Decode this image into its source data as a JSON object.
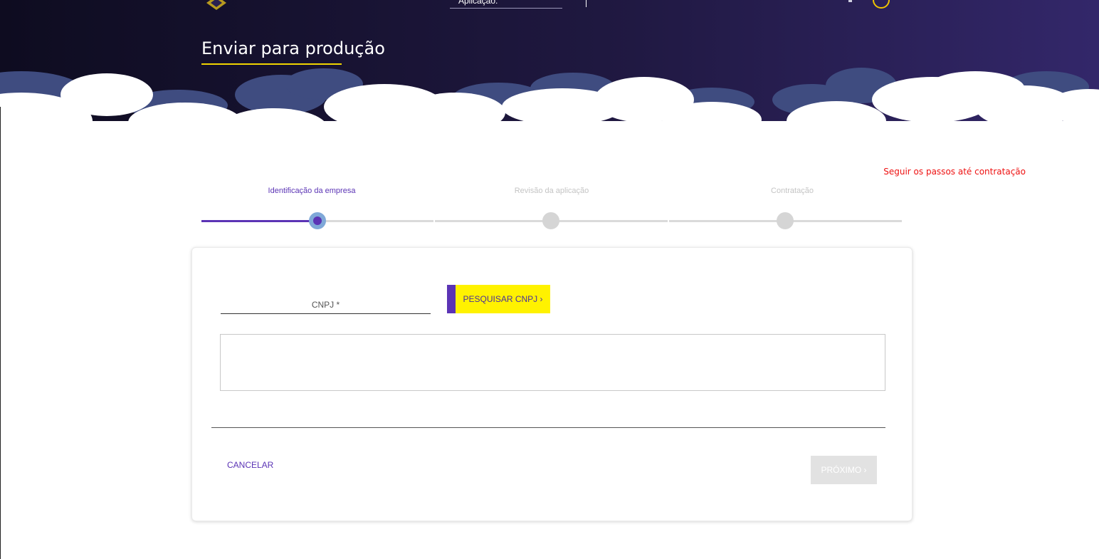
{
  "header": {
    "page_title": "Enviar para produção",
    "app_selector_label": "Aplicação:",
    "app_selector_chevron": "⌄"
  },
  "hint": "Seguir os passos até contratação",
  "stepper": {
    "steps": [
      {
        "label": "Identificação da empresa",
        "state": "active"
      },
      {
        "label": "Revisão da aplicação",
        "state": "pending"
      },
      {
        "label": "Contratação",
        "state": "pending"
      }
    ]
  },
  "form": {
    "cnpj_label": "CNPJ *",
    "cnpj_value": "",
    "search_button": "PESQUISAR CNPJ ›",
    "cancel_button": "CANCELAR",
    "next_button": "PRÓXIMO ›"
  },
  "colors": {
    "header_dark": "#110f26",
    "header_purple": "#2f2360",
    "accent_purple": "#5b34b5",
    "accent_yellow": "#fff200",
    "hint_red": "#ee1111"
  },
  "icons": {
    "logo": "bb-logo-icon",
    "user": "user-avatar-icon"
  }
}
